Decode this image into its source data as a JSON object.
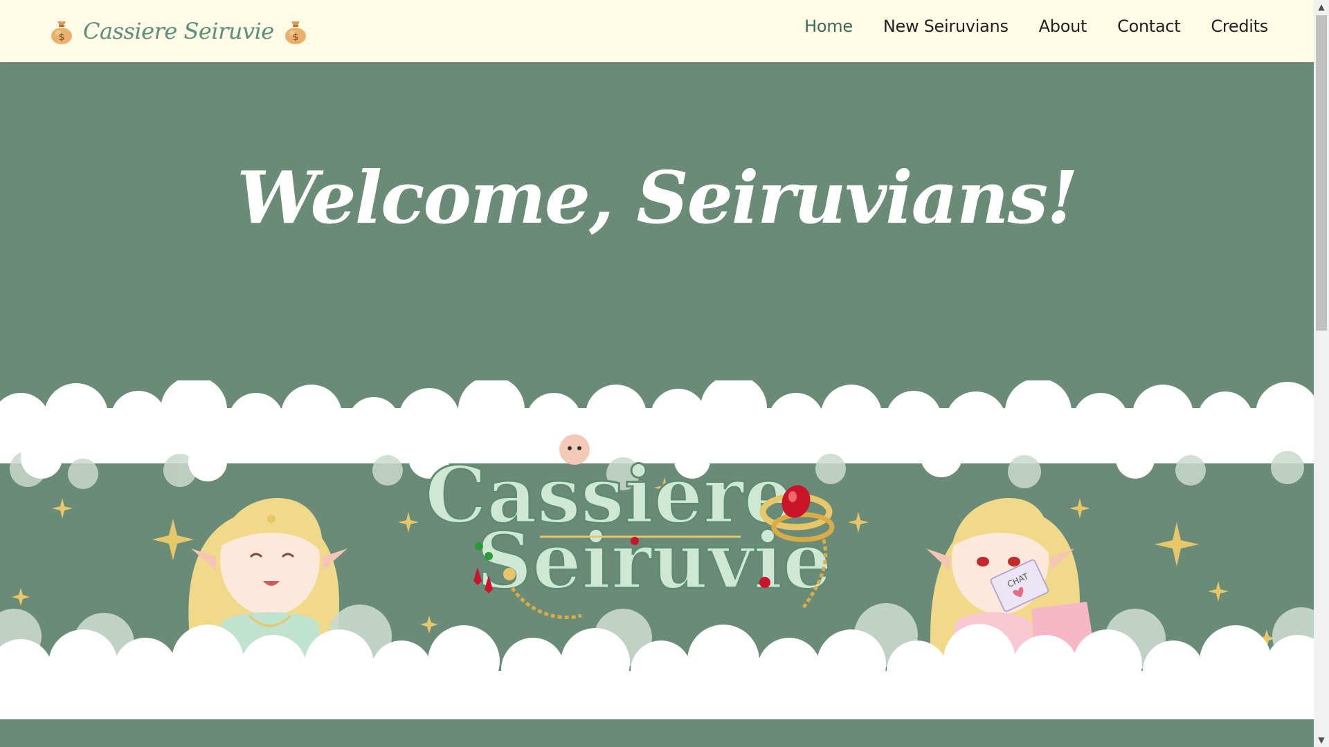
{
  "header": {
    "brand_name": "Cassiere Seiruvie",
    "nav": [
      {
        "label": "Home",
        "active": true
      },
      {
        "label": "New Seiruvians",
        "active": false
      },
      {
        "label": "About",
        "active": false
      },
      {
        "label": "Contact",
        "active": false
      },
      {
        "label": "Credits",
        "active": false
      }
    ],
    "brand_icons": [
      "money-bag-icon",
      "money-bag-icon"
    ]
  },
  "hero": {
    "heading": "Welcome, Seiruvians!",
    "banner": {
      "logo_line1": "Cassiere",
      "logo_line2": "Seiruvie",
      "envelope_text": "CHAT"
    }
  },
  "colors": {
    "header_bg": "#fffbe6",
    "hero_bg": "#6a8b77",
    "brand_text": "#5d8f7c",
    "active_nav": "#3c6b58",
    "logo_fill": "#cfe8d4",
    "gold": "#e8c66a"
  }
}
